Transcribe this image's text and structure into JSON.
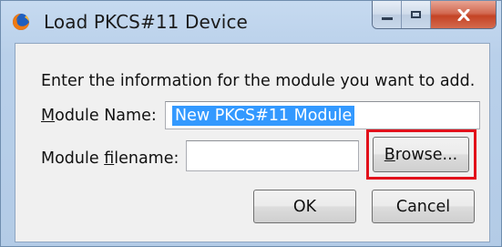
{
  "window": {
    "title": "Load PKCS#11 Device",
    "app_icon": "firefox-icon",
    "controls": {
      "minimize_icon": "minimize-icon",
      "maximize_icon": "maximize-icon",
      "close_icon": "close-icon",
      "close_glyph": "X"
    }
  },
  "dialog": {
    "instruction": "Enter the information for the module you want to add.",
    "module_name": {
      "label_prefix": "",
      "label_mnemonic": "M",
      "label_rest": "odule Name:",
      "value": "New PKCS#11 Module",
      "selected": true
    },
    "module_filename": {
      "label_prefix": "Module ",
      "label_mnemonic": "f",
      "label_rest": "ilename:",
      "value": ""
    },
    "browse_button": {
      "label_mnemonic": "B",
      "label_rest": "rowse..."
    },
    "ok_button": "OK",
    "cancel_button": "Cancel"
  },
  "annotation": {
    "highlight_color": "#e2101a",
    "target": "browse-button"
  },
  "colors": {
    "selection": "#3399ff",
    "frame": "#b9d0ea",
    "client": "#f0f0f0"
  }
}
